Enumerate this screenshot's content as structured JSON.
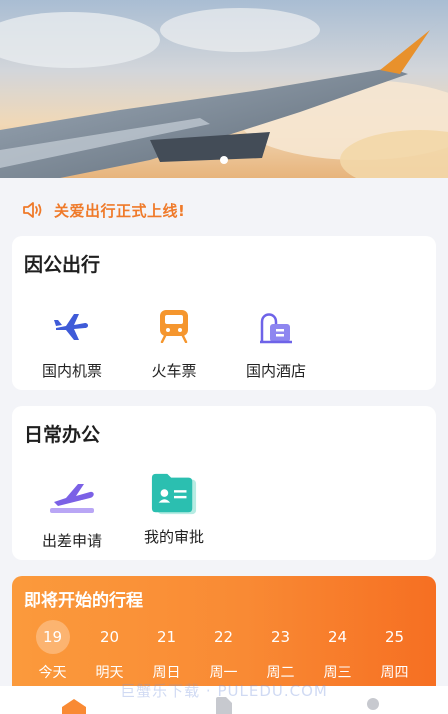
{
  "banner": {
    "active_slide": 1
  },
  "notice": {
    "text": "关爱出行正式上线!",
    "color": "#ef7a2a"
  },
  "business_travel": {
    "title": "因公出行",
    "items": [
      {
        "label": "国内机票",
        "icon": "airplane-icon"
      },
      {
        "label": "火车票",
        "icon": "train-icon"
      },
      {
        "label": "国内酒店",
        "icon": "hotel-icon"
      }
    ]
  },
  "daily_office": {
    "title": "日常办公",
    "items": [
      {
        "label": "出差申请",
        "icon": "trip-application-icon"
      },
      {
        "label": "我的审批",
        "icon": "approval-icon"
      }
    ]
  },
  "upcoming_trips": {
    "title": "即将开始的行程",
    "days": [
      {
        "date": "19",
        "weekday": "今天",
        "selected": true
      },
      {
        "date": "20",
        "weekday": "明天"
      },
      {
        "date": "21",
        "weekday": "周日"
      },
      {
        "date": "22",
        "weekday": "周一"
      },
      {
        "date": "23",
        "weekday": "周二"
      },
      {
        "date": "24",
        "weekday": "周三"
      },
      {
        "date": "25",
        "weekday": "周四"
      }
    ]
  },
  "watermark": "巨蟹乐下载 · PULEDU.COM",
  "colors": {
    "accent": "#f98a34",
    "plane_blue": "#3f5bd8",
    "train_orange": "#f5962e",
    "hotel_purple": "#6e63e8",
    "approval_teal": "#2bbfb0"
  }
}
